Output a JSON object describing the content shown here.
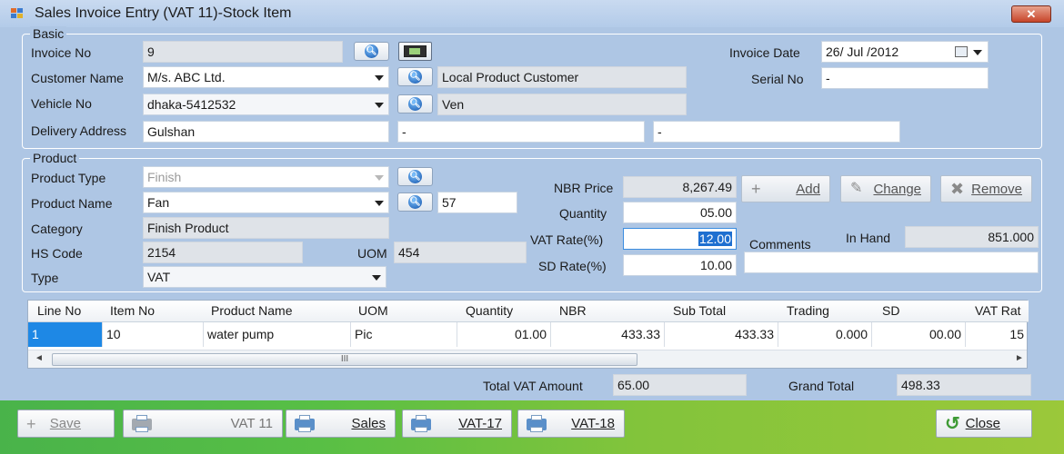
{
  "window": {
    "title": "Sales Invoice Entry (VAT 11)-Stock Item",
    "close_glyph": "✕"
  },
  "basic": {
    "legend": "Basic",
    "invoice_no_label": "Invoice No",
    "invoice_no": "9",
    "customer_name_label": "Customer Name",
    "customer_name": "M/s. ABC Ltd.",
    "customer_type": "Local Product Customer",
    "vehicle_no_label": "Vehicle No",
    "vehicle_no": "dhaka-5412532",
    "vehicle_desc": "Ven",
    "delivery_address_label": "Delivery Address",
    "delivery_address_1": "Gulshan",
    "delivery_address_2": "-",
    "delivery_address_3": "-",
    "invoice_date_label": "Invoice Date",
    "invoice_date": "26/ Jul /2012",
    "serial_no_label": "Serial No",
    "serial_no": "-"
  },
  "product": {
    "legend": "Product",
    "product_type_label": "Product Type",
    "product_type": "Finish",
    "product_name_label": "Product Name",
    "product_name": "Fan",
    "product_code": "57",
    "category_label": "Category",
    "category": "Finish Product",
    "hs_code_label": "HS Code",
    "hs_code": "2154",
    "uom_label": "UOM",
    "uom": "454",
    "type_label": "Type",
    "type": "VAT",
    "nbr_price_label": "NBR Price",
    "nbr_price": "8,267.49",
    "quantity_label": "Quantity",
    "quantity": "05.00",
    "vat_rate_label": "VAT Rate(%)",
    "vat_rate": "12.00",
    "sd_rate_label": "SD Rate(%)",
    "sd_rate": "10.00",
    "comments_label": "Comments",
    "comments": "",
    "in_hand_label": "In Hand",
    "in_hand": "851.000",
    "add_label": "Add",
    "change_label": "Change",
    "remove_label": "Remove"
  },
  "grid": {
    "columns": [
      "Line No",
      "Item No",
      "Product Name",
      "UOM",
      "Quantity",
      "NBR",
      "Sub Total",
      "Trading",
      "SD",
      "VAT Rat"
    ],
    "rows": [
      [
        "1",
        "10",
        "water pump",
        "Pic",
        "01.00",
        "433.33",
        "433.33",
        "0.000",
        "00.00",
        "15"
      ]
    ],
    "scroll_thumb": "III"
  },
  "totals": {
    "total_vat_label": "Total VAT Amount",
    "total_vat": "65.00",
    "grand_total_label": "Grand Total",
    "grand_total": "498.33"
  },
  "footer": {
    "save_label": "Save",
    "vat11_label": "VAT 11",
    "sales_label": "Sales",
    "vat17_label": "VAT-17",
    "vat18_label": "VAT-18",
    "close_label": "Close"
  },
  "colors": {
    "window_bg": "#aec6e4",
    "footer_green": "#58bf45",
    "selection_blue": "#1e88e5"
  }
}
